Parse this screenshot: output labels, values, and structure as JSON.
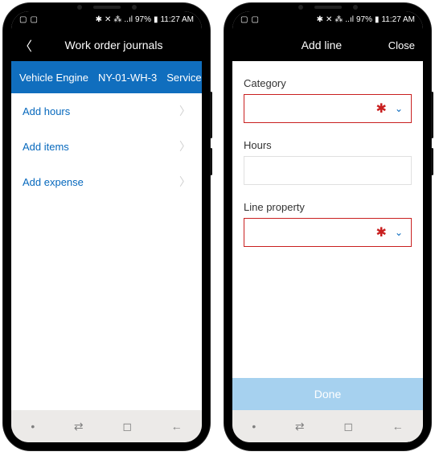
{
  "status": {
    "left_icons": [
      "▢",
      "▢"
    ],
    "right_text": "97%",
    "time": "11:27 AM",
    "bt": "✱",
    "mute": "✕",
    "wifi": "⁂",
    "sig": "▮",
    "batt": "▮"
  },
  "left_phone": {
    "header": {
      "title": "Work order journals"
    },
    "ribbon": {
      "a": "Vehicle Engine",
      "b": "NY-01-WH-3",
      "c": "Service"
    },
    "items": [
      {
        "label": "Add hours"
      },
      {
        "label": "Add items"
      },
      {
        "label": "Add expense"
      }
    ]
  },
  "right_phone": {
    "header": {
      "title": "Add line",
      "close": "Close"
    },
    "fields": {
      "category_label": "Category",
      "hours_label": "Hours",
      "lineprop_label": "Line property"
    },
    "done": "Done"
  },
  "nav": {
    "a": "•",
    "b": "⇄",
    "c": "◻",
    "d": "←"
  }
}
